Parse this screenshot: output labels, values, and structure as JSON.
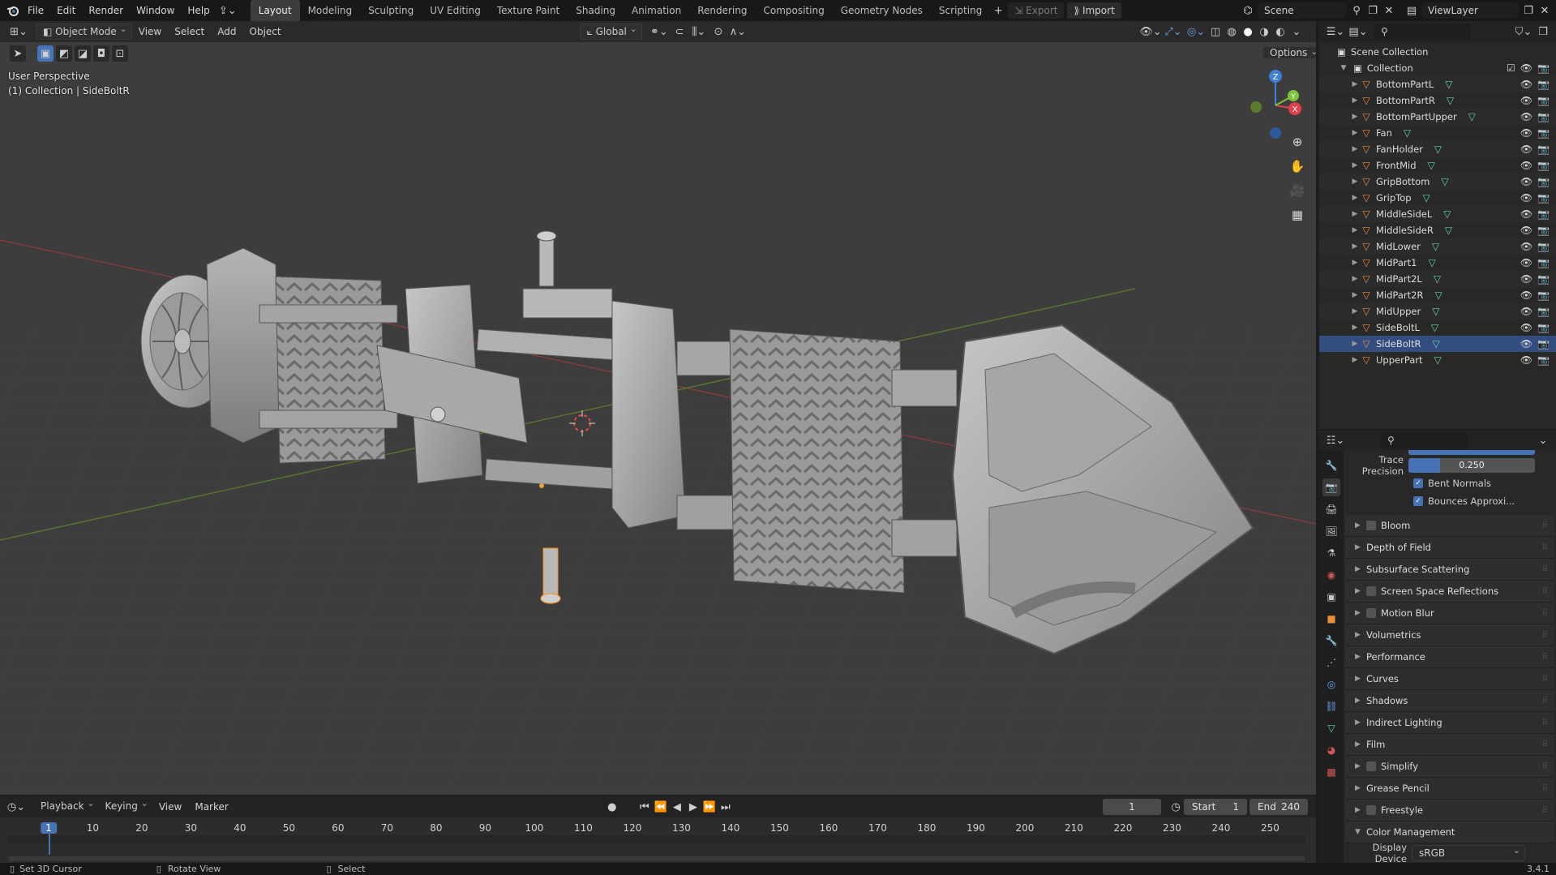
{
  "topbar": {
    "menus": [
      "File",
      "Edit",
      "Render",
      "Window",
      "Help"
    ],
    "workspaces": [
      "Layout",
      "Modeling",
      "Sculpting",
      "UV Editing",
      "Texture Paint",
      "Shading",
      "Animation",
      "Rendering",
      "Compositing",
      "Geometry Nodes",
      "Scripting"
    ],
    "active_workspace": "Layout",
    "export_label": "Export",
    "import_label": "Import",
    "scene_name": "Scene",
    "view_layer": "ViewLayer"
  },
  "viewport": {
    "mode": "Object Mode",
    "menus": [
      "View",
      "Select",
      "Add",
      "Object"
    ],
    "transform_orientation": "Global",
    "options_label": "Options",
    "overlay_line1": "User Perspective",
    "overlay_line2": "(1) Collection | SideBoltR",
    "gizmo_axes": {
      "z": "Z",
      "y": "Y",
      "x": "X"
    }
  },
  "outliner": {
    "root": "Scene Collection",
    "collection": "Collection",
    "objects": [
      "BottomPartL",
      "BottomPartR",
      "BottomPartUpper",
      "Fan",
      "FanHolder",
      "FrontMid",
      "GripBottom",
      "GripTop",
      "MiddleSideL",
      "MiddleSideR",
      "MidLower",
      "MidPart1",
      "MidPart2L",
      "MidPart2R",
      "MidUpper",
      "SideBoltL",
      "SideBoltR",
      "UpperPart"
    ],
    "active_object": "SideBoltR"
  },
  "properties": {
    "trace_precision_label": "Trace Precision",
    "trace_precision_value": "0.250",
    "bent_normals_label": "Bent Normals",
    "bounces_label": "Bounces Approxi...",
    "panels": [
      {
        "label": "Bloom",
        "checkbox": true
      },
      {
        "label": "Depth of Field",
        "checkbox": false
      },
      {
        "label": "Subsurface Scattering",
        "checkbox": false
      },
      {
        "label": "Screen Space Reflections",
        "checkbox": true
      },
      {
        "label": "Motion Blur",
        "checkbox": true
      },
      {
        "label": "Volumetrics",
        "checkbox": false
      },
      {
        "label": "Performance",
        "checkbox": false
      },
      {
        "label": "Curves",
        "checkbox": false
      },
      {
        "label": "Shadows",
        "checkbox": false
      },
      {
        "label": "Indirect Lighting",
        "checkbox": false
      },
      {
        "label": "Film",
        "checkbox": false
      },
      {
        "label": "Simplify",
        "checkbox": true
      },
      {
        "label": "Grease Pencil",
        "checkbox": false
      },
      {
        "label": "Freestyle",
        "checkbox": true
      }
    ],
    "color_mgmt_label": "Color Management",
    "display_device_label": "Display Device",
    "display_device_value": "sRGB"
  },
  "timeline": {
    "menus": [
      "Playback",
      "Keying",
      "View",
      "Marker"
    ],
    "current_frame": "1",
    "start_label": "Start",
    "start_value": "1",
    "end_label": "End",
    "end_value": "240",
    "ticks": [
      "1",
      "10",
      "20",
      "30",
      "40",
      "50",
      "60",
      "70",
      "80",
      "90",
      "100",
      "110",
      "120",
      "130",
      "140",
      "150",
      "160",
      "170",
      "180",
      "190",
      "200",
      "210",
      "220",
      "230",
      "240",
      "250"
    ]
  },
  "statusbar": {
    "hint1": "Set 3D Cursor",
    "hint2": "Rotate View",
    "hint3": "Select",
    "version": "3.4.1"
  },
  "colors": {
    "accent": "#4772b3",
    "object_orange": "#e88f3a",
    "mesh_teal": "#62d1b1",
    "x_axis": "#e0404a",
    "y_axis": "#7ec23b",
    "z_axis": "#3f7fd6"
  }
}
